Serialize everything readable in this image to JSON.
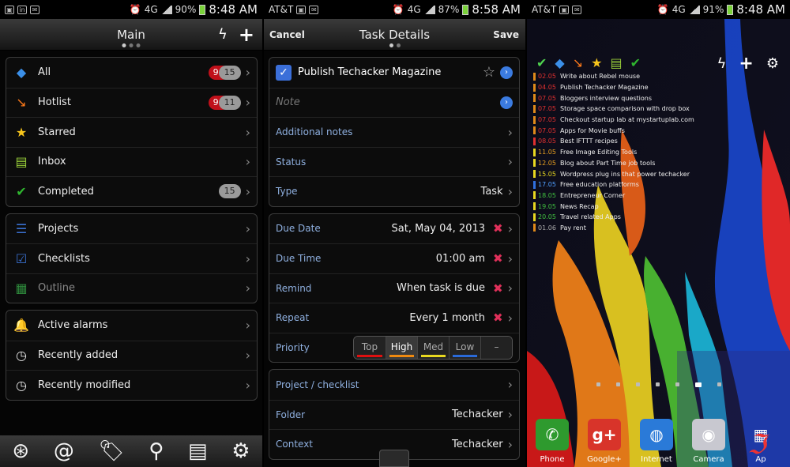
{
  "screen1": {
    "status": {
      "carrier": "",
      "battery": "90%",
      "network": "4G",
      "time": "8:48 AM"
    },
    "title": "Main",
    "groups": [
      [
        {
          "icon": "diamond-icon",
          "glyph": "◆",
          "color": "#3b8fe8",
          "label": "All",
          "red": "9",
          "gray": "15"
        },
        {
          "icon": "hotlist-icon",
          "glyph": "↘",
          "color": "#ff7a1a",
          "label": "Hotlist",
          "red": "9",
          "gray": "11"
        },
        {
          "icon": "star-icon",
          "glyph": "★",
          "color": "#f7c51c",
          "label": "Starred"
        },
        {
          "icon": "inbox-icon",
          "glyph": "▤",
          "color": "#9ad03a",
          "label": "Inbox"
        },
        {
          "icon": "check-circle-icon",
          "glyph": "✔",
          "color": "#2fb52f",
          "label": "Completed",
          "gray": "15"
        }
      ],
      [
        {
          "icon": "projects-icon",
          "glyph": "☰",
          "color": "#3a70d0",
          "label": "Projects"
        },
        {
          "icon": "checklist-icon",
          "glyph": "☑",
          "color": "#3a70d0",
          "label": "Checklists"
        },
        {
          "icon": "outline-icon",
          "glyph": "▦",
          "color": "#2e8b3c",
          "label": "Outline",
          "dim": true
        }
      ],
      [
        {
          "icon": "bell-icon",
          "glyph": "🔔",
          "color": "#d82020",
          "label": "Active alarms"
        },
        {
          "icon": "clock-doc-icon",
          "glyph": "◷",
          "color": "#e6e6e6",
          "label": "Recently added"
        },
        {
          "icon": "clock-doc-icon",
          "glyph": "◷",
          "color": "#e6e6e6",
          "label": "Recently modified"
        }
      ]
    ],
    "bottom": [
      "sync-icon",
      "at-icon",
      "tag-icon",
      "search-icon",
      "notebook-icon",
      "gear-icon"
    ]
  },
  "screen2": {
    "status": {
      "carrier": "AT&T",
      "battery": "87%",
      "network": "4G",
      "time": "8:58 AM"
    },
    "cancel": "Cancel",
    "title": "Task Details",
    "save": "Save",
    "task_name": "Publish Techacker Magazine",
    "note_placeholder": "Note",
    "additional": "Additional notes",
    "status_label": "Status",
    "type_label": "Type",
    "type_value": "Task",
    "due_date_label": "Due Date",
    "due_date": "Sat, May 04, 2013",
    "due_time_label": "Due Time",
    "due_time": "01:00 am",
    "remind_label": "Remind",
    "remind": "When task is due",
    "repeat_label": "Repeat",
    "repeat": "Every 1 month",
    "priority_label": "Priority",
    "priority": [
      {
        "label": "Top",
        "color": "#e01010"
      },
      {
        "label": "High",
        "color": "#f08a10",
        "selected": true
      },
      {
        "label": "Med",
        "color": "#e8d820"
      },
      {
        "label": "Low",
        "color": "#2a6ad8"
      },
      {
        "label": "–",
        "color": ""
      }
    ],
    "project_label": "Project / checklist",
    "folder_label": "Folder",
    "folder": "Techacker",
    "context_label": "Context",
    "context": "Techacker"
  },
  "screen3": {
    "status": {
      "carrier": "AT&T",
      "battery": "91%",
      "network": "4G",
      "time": "8:48 AM"
    },
    "tasks": [
      {
        "d": "02.05",
        "t": "Write about Rebel mouse",
        "c": "#e08a1a",
        "dc": "#e03030"
      },
      {
        "d": "04.05",
        "t": "Publish Techacker Magazine",
        "c": "#e08a1a",
        "dc": "#e03030"
      },
      {
        "d": "07.05",
        "t": "Bloggers interview questions",
        "c": "#e08a1a",
        "dc": "#e03030"
      },
      {
        "d": "07.05",
        "t": "Storage space comparison with drop box",
        "c": "#e08a1a",
        "dc": "#e03030"
      },
      {
        "d": "07.05",
        "t": "Checkout startup lab at mystartuplab.com",
        "c": "#e08a1a",
        "dc": "#e03030"
      },
      {
        "d": "07.05",
        "t": "Apps for Movie buffs",
        "c": "#e08a1a",
        "dc": "#e03030"
      },
      {
        "d": "08.05",
        "t": "Best IFTTT recipes",
        "c": "#e03030",
        "dc": "#e03030"
      },
      {
        "d": "11.05",
        "t": "Free Image Editing Tools",
        "c": "#e8d820",
        "dc": "#e8a020"
      },
      {
        "d": "12.05",
        "t": "Blog about Part Time job tools",
        "c": "#e8d820",
        "dc": "#e8a020"
      },
      {
        "d": "15.05",
        "t": "Wordpress plug ins that power techacker",
        "c": "#e8d820",
        "dc": "#e8d820"
      },
      {
        "d": "17.05",
        "t": "Free education platforms",
        "c": "#3070e0",
        "dc": "#50a0ff"
      },
      {
        "d": "18.05",
        "t": "Entrepreneur Corner",
        "c": "#e8d820",
        "dc": "#40c040"
      },
      {
        "d": "19.05",
        "t": "News Recap",
        "c": "#e8d820",
        "dc": "#40c040"
      },
      {
        "d": "20.05",
        "t": "Travel related Apps",
        "c": "#e8d820",
        "dc": "#40c040"
      },
      {
        "d": "01.06",
        "t": "Pay rent",
        "c": "#e08a1a",
        "dc": "#aaa"
      }
    ],
    "apps": [
      {
        "name": "Phone",
        "icon": "phone-icon",
        "glyph": "✆",
        "bg": "#2e9a2e"
      },
      {
        "name": "Google+",
        "icon": "google-plus-icon",
        "glyph": "g+",
        "bg": "#d8342a"
      },
      {
        "name": "Internet",
        "icon": "globe-icon",
        "glyph": "◍",
        "bg": "#2a7ad8"
      },
      {
        "name": "Camera",
        "icon": "camera-icon",
        "glyph": "◉",
        "bg": "#c8c8d0"
      },
      {
        "name": "Ap",
        "icon": "apps-grid-icon",
        "glyph": "▦",
        "bg": "transparent"
      }
    ]
  }
}
